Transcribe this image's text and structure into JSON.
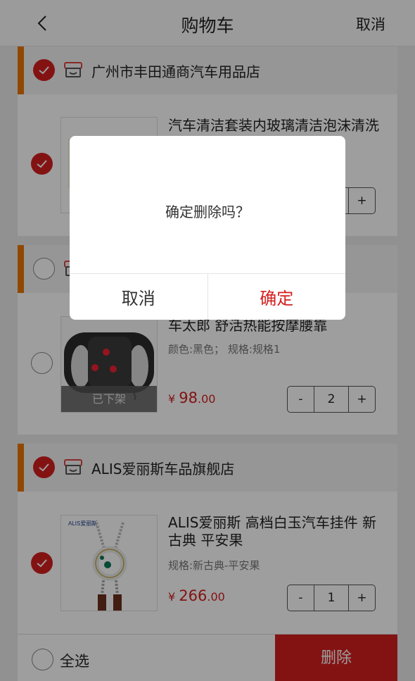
{
  "header": {
    "title": "购物车",
    "right_action": "取消"
  },
  "shops": [
    {
      "name": "广州市丰田通商汽车用品店",
      "checked": true,
      "items": [
        {
          "name": "汽车清洁套装内玻璃清洁泡沫清洗剂汽车用...",
          "spec": "",
          "price_symbol": "¥",
          "price_int": "",
          "price_dec": "",
          "qty": "",
          "checked": true,
          "status": ""
        }
      ]
    },
    {
      "name": "",
      "checked": false,
      "items": [
        {
          "name": "车太郎 舒活热能按摩腰靠",
          "spec": "颜色:黑色；  规格:规格1",
          "price_symbol": "¥",
          "price_int": "98",
          "price_dec": ".00",
          "qty": "2",
          "checked": false,
          "status": "已下架"
        }
      ]
    },
    {
      "name": "ALIS爱丽斯车品旗舰店",
      "checked": true,
      "items": [
        {
          "name": "ALIS爱丽斯 高档白玉汽车挂件 新古典 平安果",
          "spec": "规格:新古典-平安果",
          "price_symbol": "¥",
          "price_int": "266",
          "price_dec": ".00",
          "qty": "1",
          "checked": true,
          "status": ""
        }
      ]
    }
  ],
  "stepper": {
    "minus": "-",
    "plus": "+"
  },
  "footer": {
    "select_all_label": "全选",
    "delete_label": "删除"
  },
  "dialog": {
    "message": "确定删除吗？",
    "cancel_label": "取消",
    "confirm_label": "确定"
  },
  "colors": {
    "accent": "#d42020",
    "shop_bar": "#e87400",
    "overlay": "rgba(0,0,0,0.38)"
  }
}
